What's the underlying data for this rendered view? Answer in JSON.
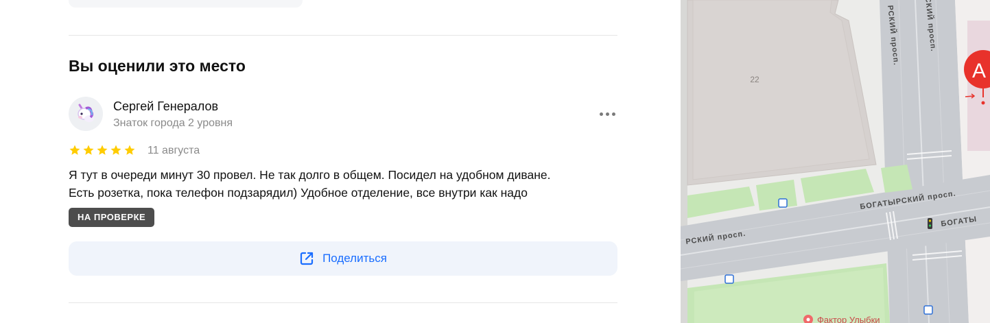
{
  "review_section": {
    "title": "Вы оценили это место",
    "author": {
      "name": "Сергей Генералов",
      "level": "Знаток города 2 уровня",
      "avatar_icon": "unicorn-icon"
    },
    "rating": 5,
    "rating_max": 5,
    "date": "11 августа",
    "text_lines": [
      "Я тут в очереди минут 30 провел. Не так долго в общем. Посидел на удобном диване.",
      "Есть розетка, пока телефон подзарядил) Удобное отделение, все внутри как надо"
    ],
    "status": "НА ПРОВЕРКЕ",
    "share_label": "Поделиться",
    "share_icon": "external-share-icon",
    "more_icon": "more-dots-icon"
  },
  "map": {
    "building_number": "22",
    "streets": {
      "vertical_left": "РСКИЙ просп.",
      "vertical_right": "СКИЙ просп.",
      "horizontal_right": "БОГАТЫРСКИЙ просп.",
      "horizontal_left": "РСКИЙ просп.",
      "horizontal_far_right": "БОГАТЫ"
    },
    "marker_letter": "А",
    "poi_label": "Фактор Улыбки",
    "colors": {
      "accent": "#196dff",
      "marker": "#e8322b",
      "badge": "#4d4d4d",
      "star": "#ffcc00"
    }
  }
}
